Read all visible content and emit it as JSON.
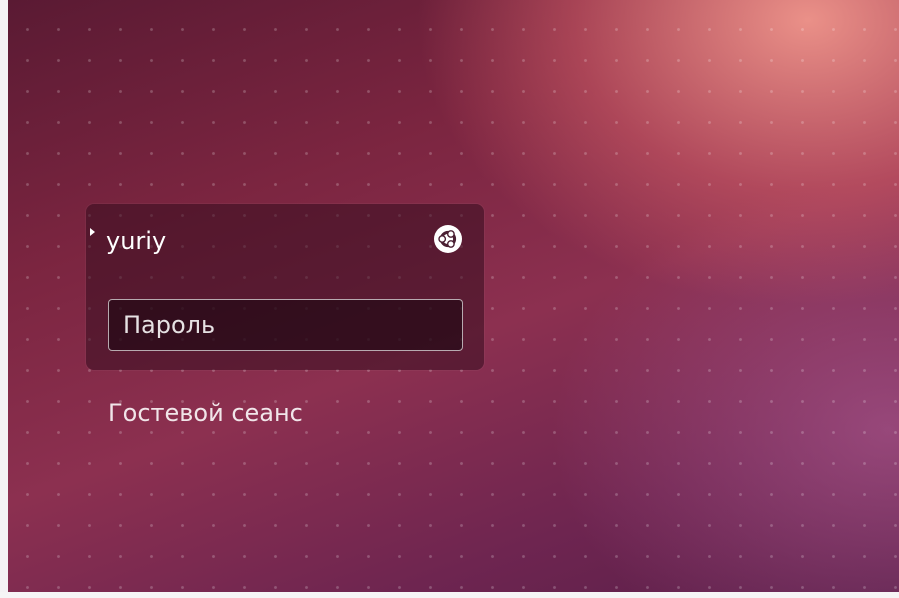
{
  "login": {
    "user_name": "yuriy",
    "password_placeholder": "Пароль",
    "session_icon": "ubuntu-session-icon"
  },
  "guest_session_label": "Гостевой сеанс",
  "colors": {
    "wallpaper_dark": "#5a1a33",
    "wallpaper_mid": "#8c3050",
    "wallpaper_highlight": "#f0968c",
    "panel": "#320c1c",
    "text": "#ffffff"
  }
}
